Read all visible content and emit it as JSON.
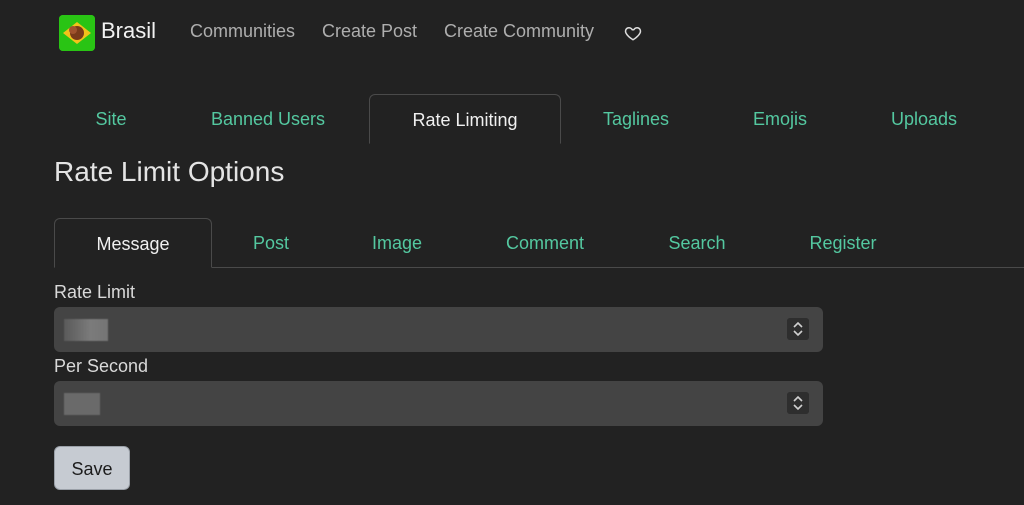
{
  "navbar": {
    "brand": "Brasil",
    "links": [
      "Communities",
      "Create Post",
      "Create Community"
    ],
    "donate_icon": "heart-icon"
  },
  "admin_tabs": {
    "items": [
      "Site",
      "Banned Users",
      "Rate Limiting",
      "Taglines",
      "Emojis",
      "Uploads"
    ],
    "active": "Rate Limiting"
  },
  "page_title": "Rate Limit Options",
  "rate_tabs": {
    "items": [
      "Message",
      "Post",
      "Image",
      "Comment",
      "Search",
      "Register"
    ],
    "active": "Message"
  },
  "form": {
    "rate_limit_label": "Rate Limit",
    "per_second_label": "Per Second",
    "save_label": "Save"
  },
  "colors": {
    "background": "#222222",
    "accent": "#54c8a0",
    "logo_bg": "#29c414"
  }
}
